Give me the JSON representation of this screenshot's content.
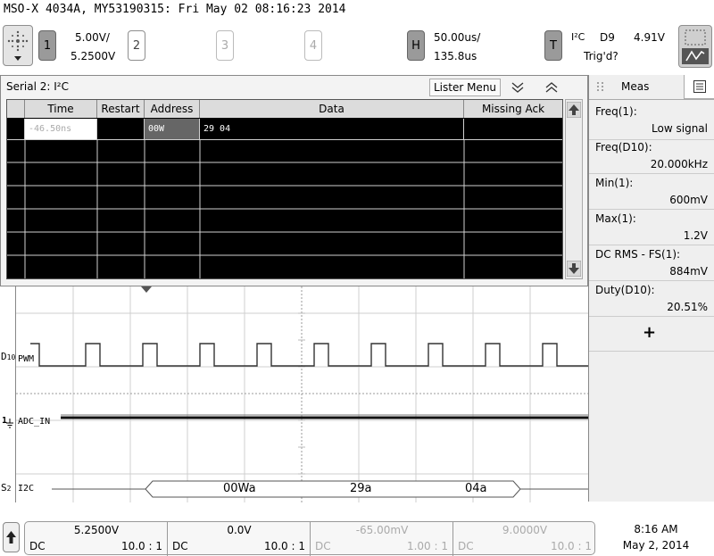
{
  "title": "MSO-X 4034A, MY53190315: Fri May 02 08:16:23 2014",
  "channels": [
    {
      "label": "1",
      "scale": "5.00V/",
      "offset": "5.2500V",
      "active": true
    },
    {
      "label": "2",
      "active": false
    },
    {
      "label": "3",
      "active": false
    },
    {
      "label": "4",
      "active": false
    }
  ],
  "horizontal": {
    "label": "H",
    "scale": "50.00us/",
    "delay": "135.8us"
  },
  "trigger": {
    "label": "T",
    "type": "I²C",
    "source": "D9",
    "level": "4.91V",
    "status": "Trig'd?"
  },
  "panel": {
    "title": "Serial 2: I²C",
    "lister_menu": "Lister Menu",
    "columns": [
      "",
      "Time",
      "Restart",
      "Address",
      "Data",
      "Missing Ack"
    ],
    "rows": [
      {
        "time": "-46.50ns",
        "restart": "",
        "address": "00W",
        "data": "29 04",
        "missing_ack": ""
      }
    ]
  },
  "meas": {
    "tab": "Meas",
    "items": [
      {
        "label": "Freq(1):",
        "value": "Low signal"
      },
      {
        "label": "Freq(D10):",
        "value": "20.000kHz"
      },
      {
        "label": "Min(1):",
        "value": "600mV"
      },
      {
        "label": "Max(1):",
        "value": "1.2V"
      },
      {
        "label": "DC RMS - FS(1):",
        "value": "884mV"
      },
      {
        "label": "Duty(D10):",
        "value": "20.51%"
      }
    ],
    "add": "+"
  },
  "waveform": {
    "d10_prefix": "D",
    "d10_sub": "10",
    "d10_name": "PWM",
    "ch1_marker": "1",
    "ch1_name": "ADC_IN",
    "s2_prefix": "S",
    "s2_sub": "2",
    "s2_name": "I2C",
    "bus_values": [
      "00Wa",
      "29a",
      "04a"
    ]
  },
  "bottom": {
    "channels": [
      {
        "value": "5.2500V",
        "coupling": "DC",
        "probe": "10.0 : 1",
        "active": true
      },
      {
        "value": "0.0V",
        "coupling": "DC",
        "probe": "10.0 : 1",
        "active": true
      },
      {
        "value": "-65.00mV",
        "coupling": "DC",
        "probe": "1.00 : 1",
        "active": false
      },
      {
        "value": "9.0000V",
        "coupling": "DC",
        "probe": "10.0 : 1",
        "active": false
      }
    ],
    "time": "8:16 AM",
    "date": "May 2, 2014"
  }
}
